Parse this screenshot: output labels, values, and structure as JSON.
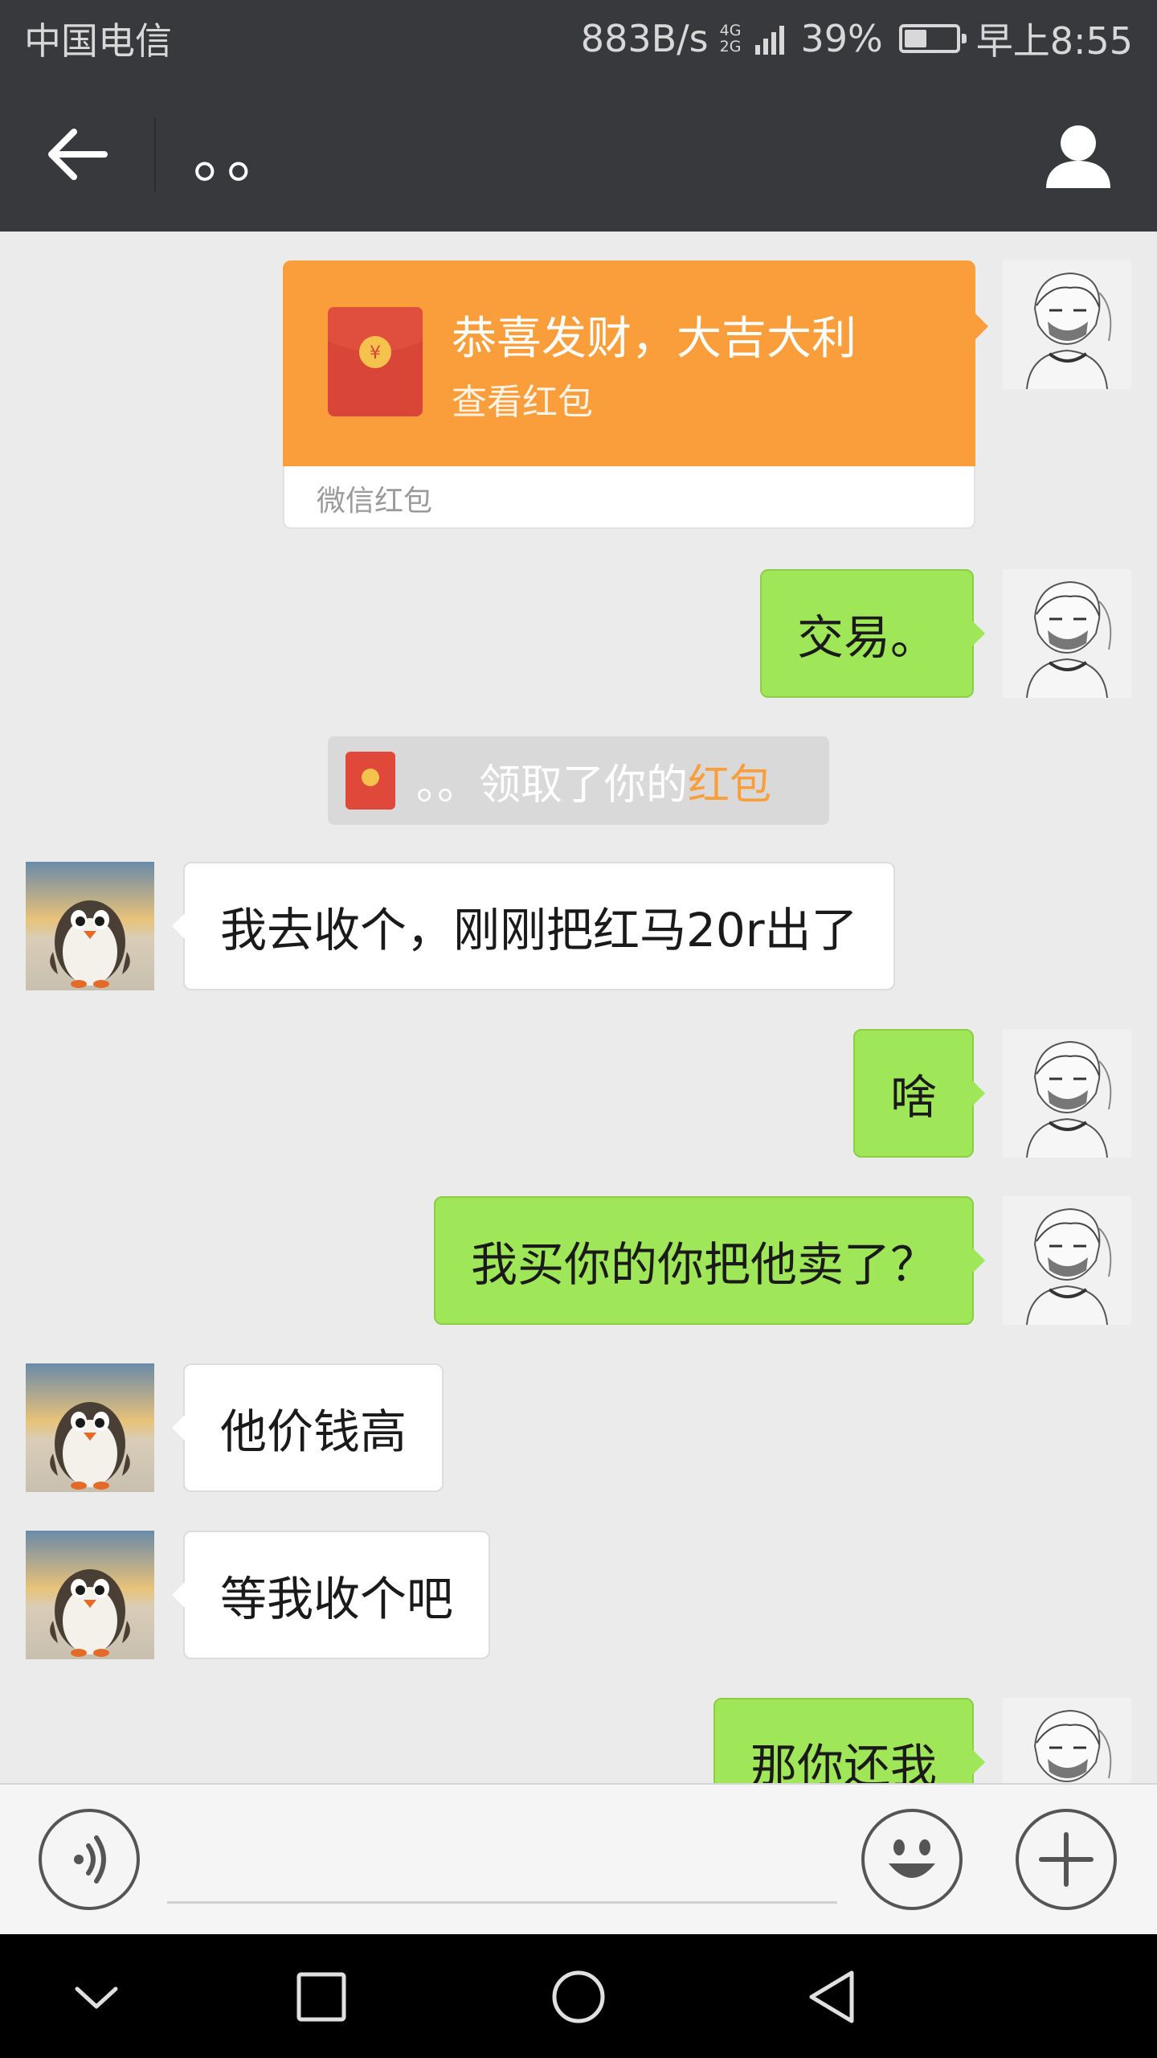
{
  "status_bar": {
    "carrier": "中国电信",
    "speed": "883B/s",
    "net_top": "4G",
    "net_bottom": "2G",
    "battery_percent": "39%",
    "battery_level": 0.39,
    "time": "早上8:55"
  },
  "header": {
    "title": "。。",
    "back_icon": "arrow-left-icon",
    "profile_icon": "person-icon"
  },
  "red_packet": {
    "title": "恭喜发财，大吉大利",
    "subtitle": "查看红包",
    "footer": "微信红包",
    "icon": "red-envelope-icon",
    "card_color": "#f99e3b"
  },
  "notice": {
    "prefix": "。。领取了你的",
    "link": "红包",
    "link_color": "#fa9d3b"
  },
  "messages": [
    {
      "side": "self",
      "text": "交易。"
    },
    {
      "side": "peer",
      "text": "我去收个，刚刚把红马20r出了"
    },
    {
      "side": "self",
      "text": "啥"
    },
    {
      "side": "self",
      "text": "我买你的你把他卖了？"
    },
    {
      "side": "peer",
      "text": "他价钱高"
    },
    {
      "side": "peer",
      "text": "等我收个吧"
    },
    {
      "side": "self",
      "text": "那你还我"
    }
  ],
  "colors": {
    "header_bg": "#38393d",
    "chat_bg": "#ebebeb",
    "self_bubble": "#9fe658",
    "peer_bubble": "#ffffff"
  },
  "input_bar": {
    "voice_icon": "voice-icon",
    "emoji_icon": "emoji-icon",
    "more_icon": "plus-icon",
    "value": ""
  },
  "nav_bar": {
    "icons": [
      "chevron-down-icon",
      "square-icon",
      "circle-icon",
      "triangle-back-icon"
    ]
  }
}
